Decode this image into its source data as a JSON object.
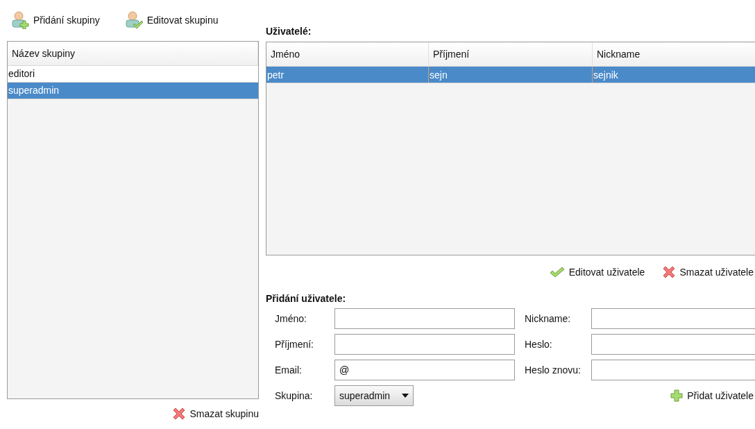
{
  "toolbar": [
    {
      "kind": "add",
      "label": "Přidání skupiny"
    },
    {
      "kind": "edit",
      "label": "Editovat skupinu"
    }
  ],
  "groups": {
    "column": "Název skupiny",
    "rows": [
      {
        "name": "editori",
        "selected": false
      },
      {
        "name": "superadmin",
        "selected": true
      }
    ]
  },
  "delete_group": {
    "kind": "delete",
    "label": "Smazat skupinu"
  },
  "users": {
    "title": "Uživatelé:",
    "columns": [
      "Jméno",
      "Příjmení",
      "Nickname"
    ],
    "rows": [
      {
        "cells": [
          "petr",
          "sejn",
          "sejnik"
        ],
        "selected": true
      }
    ]
  },
  "user_actions": [
    {
      "kind": "edit",
      "label": "Editovat uživatele"
    },
    {
      "kind": "delete",
      "label": "Smazat uživatele"
    }
  ],
  "add_user": {
    "title": "Přidání uživatele:",
    "fields": [
      {
        "label": "Jméno:"
      },
      {
        "label": "Nickname:"
      },
      {
        "label": "Příjmení:"
      },
      {
        "label": "Heslo:"
      },
      {
        "label": "Email:",
        "value": "@"
      },
      {
        "label": "Heslo znovu:"
      }
    ],
    "group_label": "Skupina:",
    "group_value": "superadmin",
    "submit": {
      "kind": "add",
      "label": "Přidat uživatele"
    }
  }
}
